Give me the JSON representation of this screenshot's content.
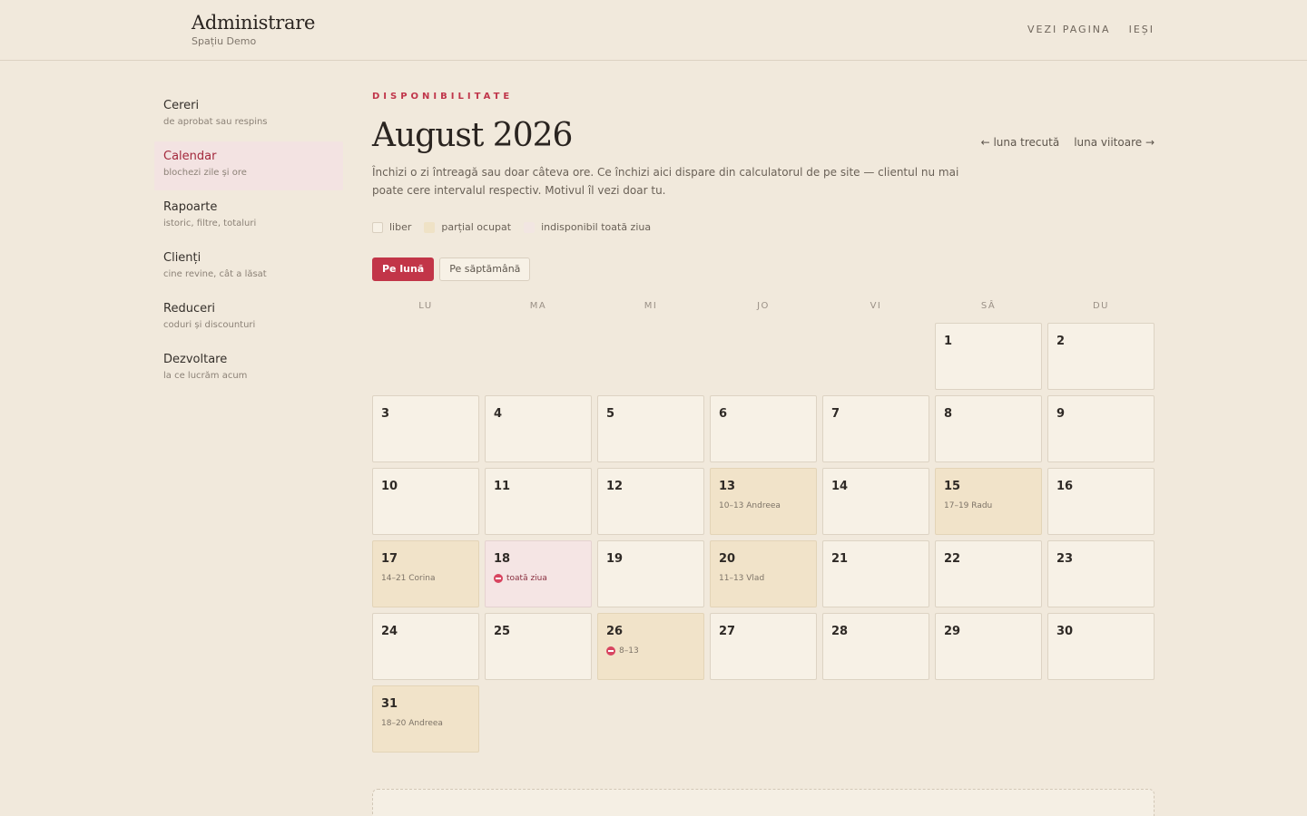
{
  "header": {
    "title": "Administrare",
    "subtitle": "Spațiu Demo",
    "nav": [
      "VEZI PAGINA",
      "IEȘI"
    ]
  },
  "sidebar": {
    "items": [
      {
        "label": "Cereri",
        "desc": "de aprobat sau respins",
        "active": false
      },
      {
        "label": "Calendar",
        "desc": "blochezi zile și ore",
        "active": true
      },
      {
        "label": "Rapoarte",
        "desc": "istoric, filtre, totaluri",
        "active": false
      },
      {
        "label": "Clienți",
        "desc": "cine revine, cât a lăsat",
        "active": false
      },
      {
        "label": "Reduceri",
        "desc": "coduri și discounturi",
        "active": false
      },
      {
        "label": "Dezvoltare",
        "desc": "la ce lucrăm acum",
        "active": false
      }
    ]
  },
  "main": {
    "eyebrow": "DISPONIBILITATE",
    "title": "August 2026",
    "prev_month": "← luna trecută",
    "next_month": "luna viitoare →",
    "description": "Închizi o zi întreagă sau doar câteva ore. Ce închizi aici dispare din calculatorul de pe site — clientul nu mai poate cere intervalul respectiv. Motivul îl vezi doar tu.",
    "legend": {
      "free": "liber",
      "partial": "parțial ocupat",
      "unavailable": "indisponibil toată ziua"
    },
    "view_month": "Pe lună",
    "view_week": "Pe săptămână"
  },
  "calendar": {
    "weekdays": [
      "LU",
      "MA",
      "MI",
      "JO",
      "VI",
      "SÂ",
      "DU"
    ],
    "first_weekday_index": 5,
    "days": [
      {
        "day": "1",
        "status": "free",
        "note": ""
      },
      {
        "day": "2",
        "status": "free",
        "note": ""
      },
      {
        "day": "3",
        "status": "free",
        "note": ""
      },
      {
        "day": "4",
        "status": "free",
        "note": ""
      },
      {
        "day": "5",
        "status": "free",
        "note": ""
      },
      {
        "day": "6",
        "status": "free",
        "note": ""
      },
      {
        "day": "7",
        "status": "free",
        "note": ""
      },
      {
        "day": "8",
        "status": "free",
        "note": ""
      },
      {
        "day": "9",
        "status": "free",
        "note": ""
      },
      {
        "day": "10",
        "status": "free",
        "note": ""
      },
      {
        "day": "11",
        "status": "free",
        "note": ""
      },
      {
        "day": "12",
        "status": "free",
        "note": ""
      },
      {
        "day": "13",
        "status": "partial",
        "note": "10–13 Andreea"
      },
      {
        "day": "14",
        "status": "free",
        "note": ""
      },
      {
        "day": "15",
        "status": "partial",
        "note": "17–19 Radu"
      },
      {
        "day": "16",
        "status": "free",
        "note": ""
      },
      {
        "day": "17",
        "status": "partial",
        "note": "14–21 Corina"
      },
      {
        "day": "18",
        "status": "unavailable",
        "note": "toată ziua",
        "blocked": true
      },
      {
        "day": "19",
        "status": "free",
        "note": ""
      },
      {
        "day": "20",
        "status": "partial",
        "note": "11–13 Vlad"
      },
      {
        "day": "21",
        "status": "free",
        "note": ""
      },
      {
        "day": "22",
        "status": "free",
        "note": ""
      },
      {
        "day": "23",
        "status": "free",
        "note": ""
      },
      {
        "day": "24",
        "status": "free",
        "note": ""
      },
      {
        "day": "25",
        "status": "free",
        "note": ""
      },
      {
        "day": "26",
        "status": "partial",
        "note": "8–13",
        "blocked": true
      },
      {
        "day": "27",
        "status": "free",
        "note": ""
      },
      {
        "day": "28",
        "status": "free",
        "note": ""
      },
      {
        "day": "29",
        "status": "free",
        "note": ""
      },
      {
        "day": "30",
        "status": "free",
        "note": ""
      },
      {
        "day": "31",
        "status": "partial",
        "note": "18–20 Andreea"
      }
    ]
  },
  "colors": {
    "accent": "#c23548",
    "background": "#f1e9dc",
    "cell_free": "#f7f1e6",
    "cell_partial": "#f1e3c9",
    "cell_unavailable": "#f5e5e4"
  }
}
